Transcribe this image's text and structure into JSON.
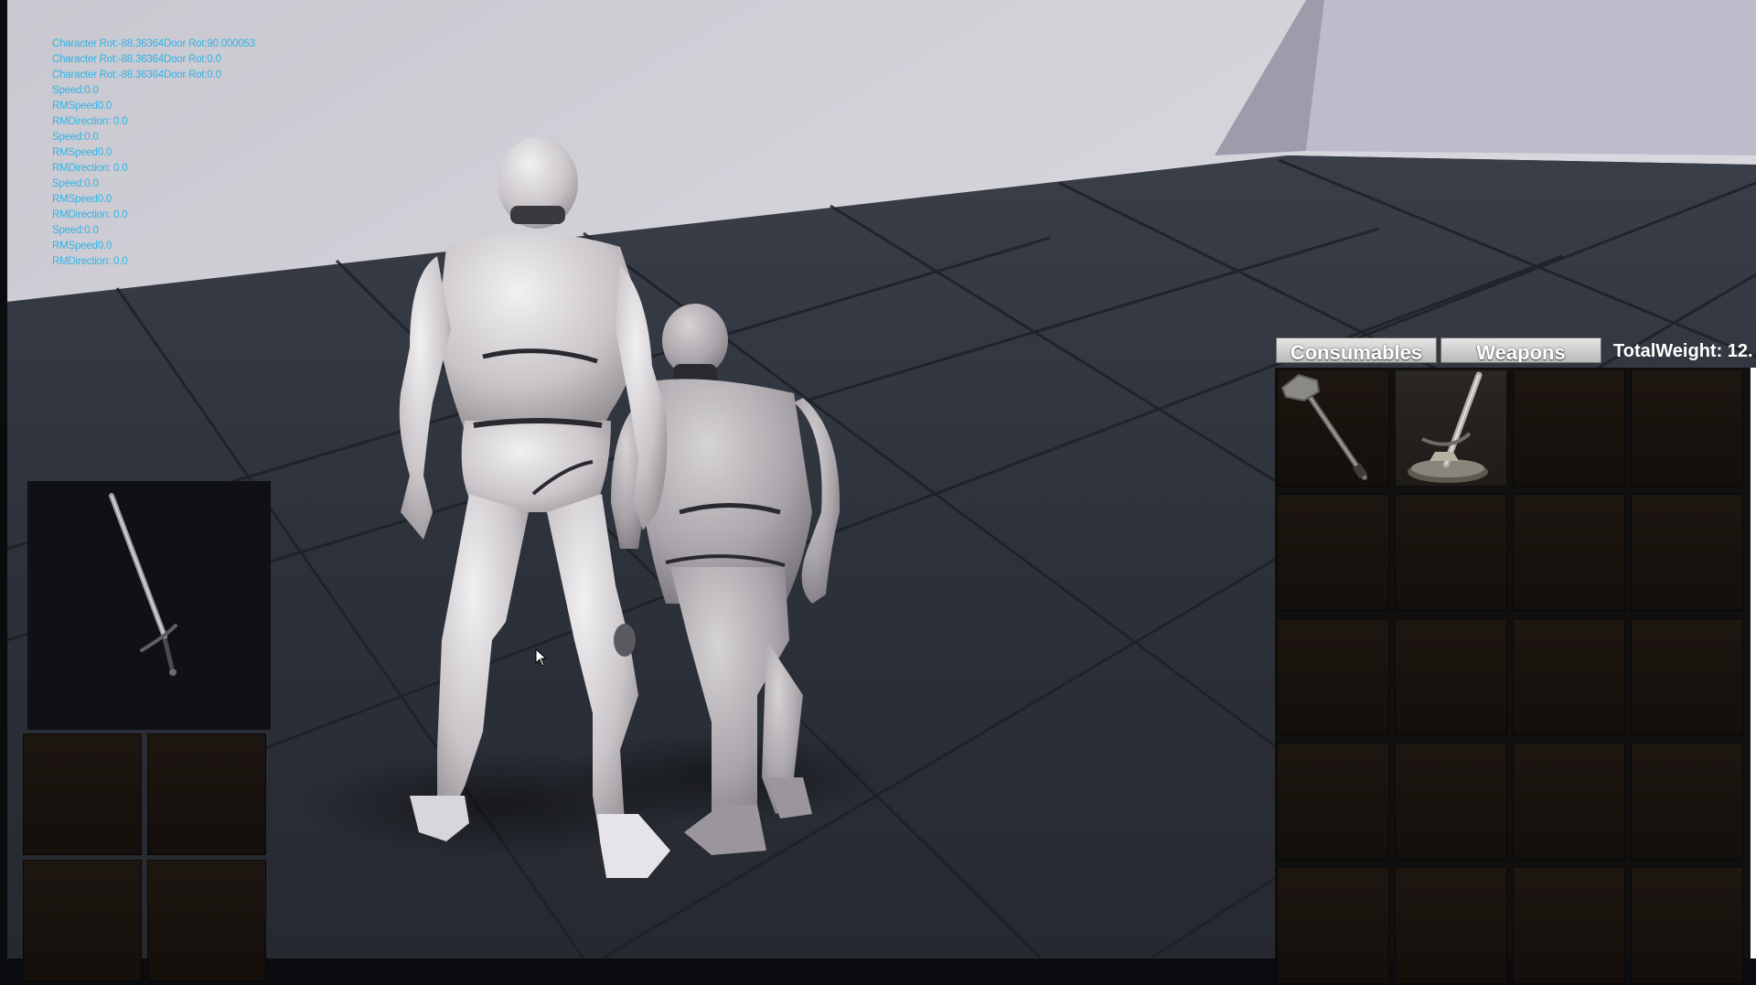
{
  "debug_log": [
    "Character Rot:-88.36364Door Rot:90.000053",
    "Character Rot:-88.36364Door Rot:0.0",
    "Character Rot:-88.36364Door Rot:0.0",
    "Speed:0.0",
    "RMSpeed0.0",
    "RMDirection: 0.0",
    "Speed:0.0",
    "RMSpeed0.0",
    "RMDirection: 0.0",
    "Speed:0.0",
    "RMSpeed0.0",
    "RMDirection: 0.0",
    "Speed:0.0",
    "RMSpeed0.0",
    "RMDirection: 0.0"
  ],
  "inventory": {
    "tabs": {
      "consumables": "Consumables",
      "weapons": "Weapons"
    },
    "total_weight": "TotalWeight: 12.",
    "slots": [
      {
        "item": "warhammer-icon"
      },
      {
        "item": "greatsword-icon"
      },
      {
        "item": null
      },
      {
        "item": null
      },
      {
        "item": null
      },
      {
        "item": null
      },
      {
        "item": null
      },
      {
        "item": null
      },
      {
        "item": null
      },
      {
        "item": null
      },
      {
        "item": null
      },
      {
        "item": null
      },
      {
        "item": null
      },
      {
        "item": null
      },
      {
        "item": null
      },
      {
        "item": null
      },
      {
        "item": null
      },
      {
        "item": null
      },
      {
        "item": null
      },
      {
        "item": null
      }
    ]
  },
  "equipped": {
    "preview_item": "longsword-icon",
    "slots": [
      {
        "item": null
      },
      {
        "item": null
      },
      {
        "item": null
      },
      {
        "item": null
      }
    ]
  },
  "colors": {
    "debug_text": "#2fb4e6",
    "slot_bg": "#1a130e",
    "tab_bg": "#d3d3d3"
  }
}
